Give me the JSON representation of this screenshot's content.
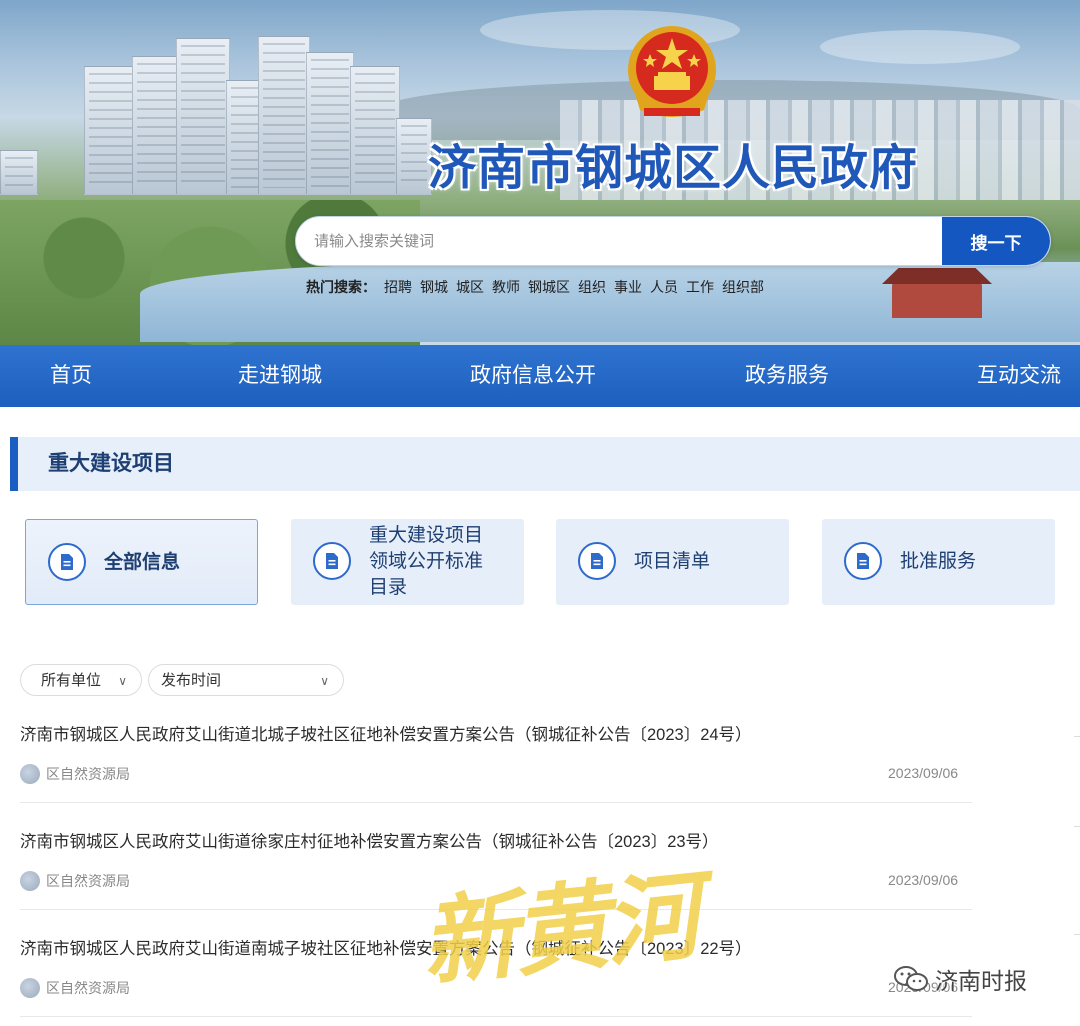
{
  "header": {
    "site_title": "济南市钢城区人民政府",
    "search": {
      "placeholder": "请输入搜索关键词",
      "button": "搜一下"
    },
    "hot_label": "热门搜索：",
    "hot_keywords": [
      "招聘",
      "钢城",
      "城区",
      "教师",
      "钢城区",
      "组织",
      "事业",
      "人员",
      "工作",
      "组织部"
    ]
  },
  "nav": [
    "首页",
    "走进钢城",
    "政府信息公开",
    "政务服务",
    "互动交流"
  ],
  "section": {
    "title": "重大建设项目",
    "categories": [
      {
        "label": "全部信息",
        "active": true
      },
      {
        "label": "重大建设项目领域公开标准目录",
        "active": false
      },
      {
        "label": "项目清单",
        "active": false
      },
      {
        "label": "批准服务",
        "active": false
      }
    ]
  },
  "filters": {
    "unit": "所有单位",
    "time": "发布时间"
  },
  "list": [
    {
      "title": "济南市钢城区人民政府艾山街道北城子坡社区征地补偿安置方案公告（钢城征补公告〔2023〕24号）",
      "org": "区自然资源局",
      "date": "2023/09/06"
    },
    {
      "title": "济南市钢城区人民政府艾山街道徐家庄村征地补偿安置方案公告（钢城征补公告〔2023〕23号）",
      "org": "区自然资源局",
      "date": "2023/09/06"
    },
    {
      "title": "济南市钢城区人民政府艾山街道南城子坡社区征地补偿安置方案公告（钢城征补公告〔2023〕22号）",
      "org": "区自然资源局",
      "date": "2023/09/06"
    }
  ],
  "watermark": {
    "big": "新黄河",
    "small": "济南时报"
  },
  "colors": {
    "primary": "#1d5fbe",
    "title_blue": "#1f58b8",
    "section_bg": "#e7effb",
    "watermark_yellow": "#f1d048"
  }
}
